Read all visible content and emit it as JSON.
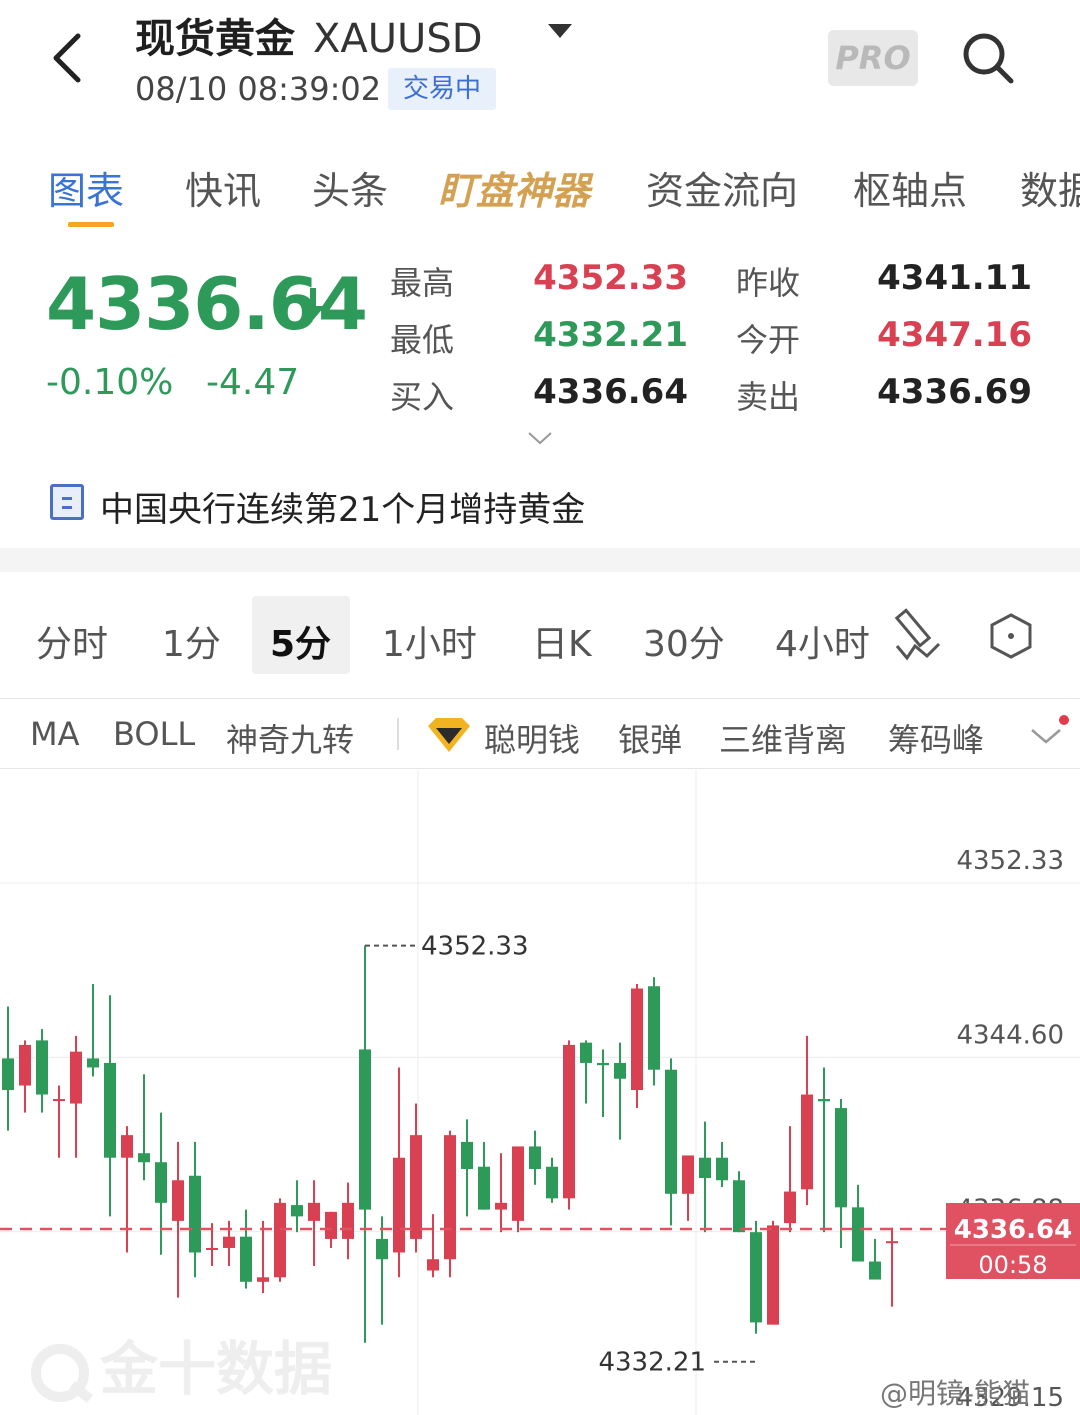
{
  "header": {
    "name": "现货黄金",
    "symbol": "XAUUSD",
    "datetime": "08/10 08:39:02",
    "status": "交易中",
    "pro_badge": "PRO"
  },
  "tabs": [
    "图表",
    "快讯",
    "头条",
    "盯盘神器",
    "资金流向",
    "枢轴点",
    "数据"
  ],
  "quote": {
    "price": "4336.64",
    "change_pct": "-0.10%",
    "change": "-4.47",
    "high_label": "最高",
    "high": "4352.33",
    "low_label": "最低",
    "low": "4332.21",
    "bid_label": "买入",
    "bid": "4336.64",
    "prev_close_label": "昨收",
    "prev_close": "4341.11",
    "open_label": "今开",
    "open": "4347.16",
    "ask_label": "卖出",
    "ask": "4336.69"
  },
  "news": "中国央行连续第21个月增持黄金",
  "periods": [
    "分时",
    "1分",
    "5分",
    "1小时",
    "日K",
    "30分",
    "4小时"
  ],
  "indicators": [
    "MA",
    "BOLL",
    "神奇九转",
    "聪明钱",
    "银弹",
    "三维背离",
    "筹码峰"
  ],
  "chart_data": {
    "type": "candlestick",
    "y_ticks": [
      "4352.33",
      "4344.60",
      "4336.88",
      "4329.15"
    ],
    "high_label": "4352.33",
    "low_label": "4332.21",
    "current_price": "4336.64",
    "countdown": "00:58",
    "colors": {
      "up": "#d94152",
      "down": "#2e9a5a"
    },
    "candles": [
      [
        4344.2,
        4346.5,
        4341.0,
        4342.8
      ],
      [
        4343.0,
        4345.0,
        4341.8,
        4344.8
      ],
      [
        4345.0,
        4345.5,
        4341.8,
        4342.6
      ],
      [
        4342.4,
        4343.0,
        4339.8,
        4342.4
      ],
      [
        4342.2,
        4345.2,
        4339.8,
        4344.5
      ],
      [
        4344.2,
        4347.5,
        4343.4,
        4343.8
      ],
      [
        4344.0,
        4347.0,
        4337.2,
        4339.8
      ],
      [
        4339.8,
        4341.2,
        4335.6,
        4340.8
      ],
      [
        4340.0,
        4343.5,
        4338.8,
        4339.6
      ],
      [
        4339.6,
        4341.8,
        4335.5,
        4337.8
      ],
      [
        4337.0,
        4340.5,
        4333.6,
        4338.8
      ],
      [
        4339.0,
        4340.5,
        4334.5,
        4335.6
      ],
      [
        4335.8,
        4336.9,
        4335.0,
        4335.8
      ],
      [
        4335.8,
        4337.0,
        4335.0,
        4336.3
      ],
      [
        4336.3,
        4337.5,
        4334.0,
        4334.3
      ],
      [
        4334.3,
        4337.0,
        4333.8,
        4334.5
      ],
      [
        4334.5,
        4338.0,
        4334.3,
        4337.8
      ],
      [
        4337.7,
        4338.8,
        4336.5,
        4337.2
      ],
      [
        4337.0,
        4338.8,
        4335.0,
        4337.8
      ],
      [
        4336.2,
        4337.4,
        4335.8,
        4337.4
      ],
      [
        4336.2,
        4338.7,
        4335.3,
        4337.8
      ],
      [
        4344.6,
        4349.2,
        4331.6,
        4337.5
      ],
      [
        4336.2,
        4337.2,
        4332.4,
        4335.3
      ],
      [
        4335.6,
        4343.8,
        4334.5,
        4339.8
      ],
      [
        4336.2,
        4342.2,
        4335.6,
        4340.8
      ],
      [
        4334.8,
        4337.3,
        4334.5,
        4335.3
      ],
      [
        4335.3,
        4341.0,
        4334.5,
        4340.8
      ],
      [
        4340.5,
        4341.5,
        4337.2,
        4339.3
      ],
      [
        4339.4,
        4340.5,
        4337.5,
        4337.5
      ],
      [
        4337.5,
        4340.0,
        4336.5,
        4337.8
      ],
      [
        4337.0,
        4340.0,
        4336.5,
        4340.3
      ],
      [
        4340.3,
        4341.0,
        4338.6,
        4339.3
      ],
      [
        4339.4,
        4339.8,
        4337.8,
        4338.0
      ],
      [
        4338.0,
        4345.0,
        4337.5,
        4344.8
      ],
      [
        4344.9,
        4345.0,
        4342.2,
        4344.0
      ],
      [
        4344.0,
        4344.6,
        4341.6,
        4343.9
      ],
      [
        4344.0,
        4344.9,
        4340.6,
        4343.3
      ],
      [
        4342.8,
        4347.5,
        4342.0,
        4347.3
      ],
      [
        4347.4,
        4347.8,
        4343.0,
        4343.7
      ],
      [
        4343.7,
        4344.2,
        4336.8,
        4338.2
      ],
      [
        4338.2,
        4339.3,
        4337.0,
        4339.9
      ],
      [
        4339.8,
        4341.4,
        4336.5,
        4338.9
      ],
      [
        4339.8,
        4340.5,
        4338.5,
        4338.8
      ],
      [
        4338.8,
        4339.2,
        4336.5,
        4336.5
      ],
      [
        4336.5,
        4337.0,
        4332.0,
        4332.5
      ],
      [
        4332.4,
        4337.0,
        4332.6,
        4336.8
      ],
      [
        4336.9,
        4341.2,
        4336.5,
        4338.3
      ],
      [
        4338.4,
        4345.2,
        4337.7,
        4342.6
      ],
      [
        4342.4,
        4343.8,
        4336.5,
        4342.3
      ],
      [
        4342.0,
        4342.4,
        4335.8,
        4337.6
      ],
      [
        4337.6,
        4338.6,
        4336.6,
        4335.2
      ],
      [
        4335.2,
        4336.2,
        4335.0,
        4334.4
      ],
      [
        4336.1,
        4336.7,
        4333.2,
        4336.1
      ]
    ]
  }
}
